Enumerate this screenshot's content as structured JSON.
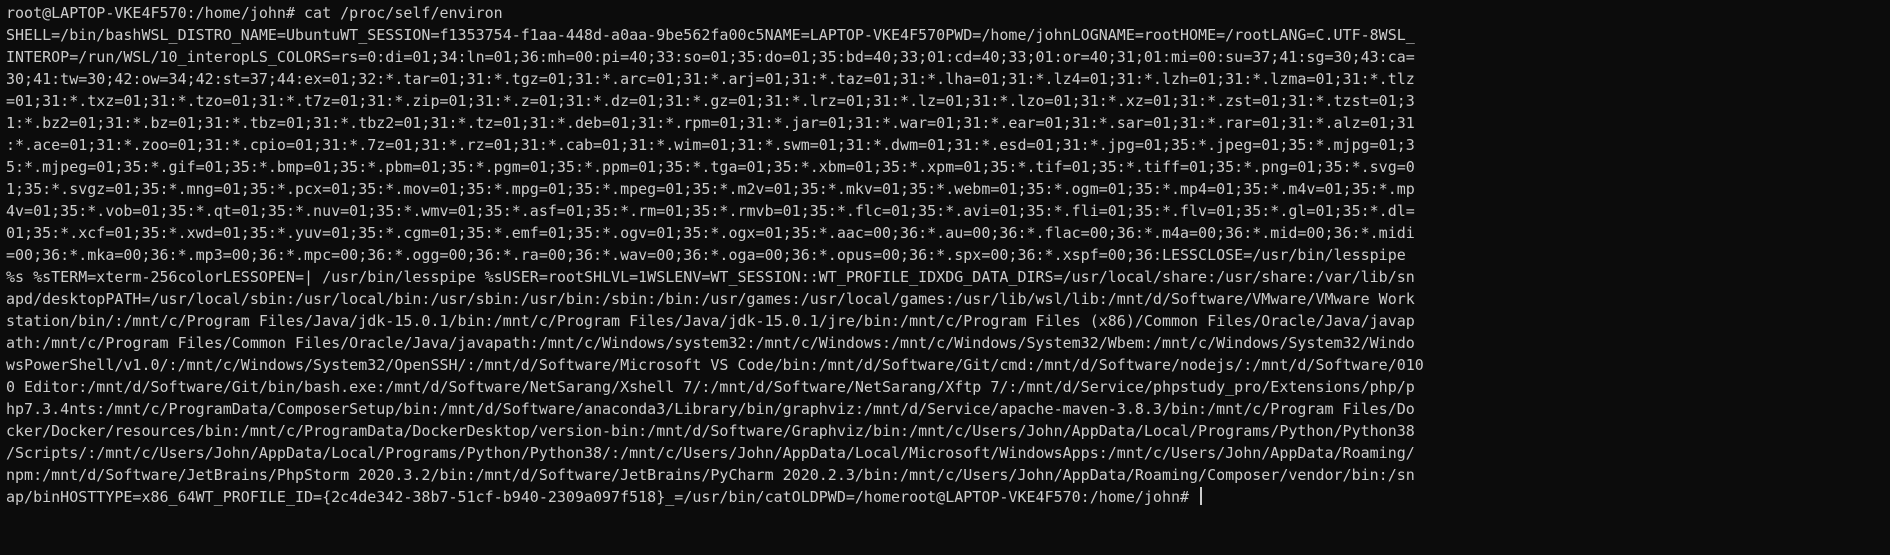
{
  "terminal": {
    "prompt": "root@LAPTOP-VKE4F570:/home/john#",
    "command": "cat /proc/self/environ",
    "output_lines": [
      "SHELL=/bin/bashWSL_DISTRO_NAME=UbuntuWT_SESSION=f1353754-f1aa-448d-a0aa-9be562fa00c5NAME=LAPTOP-VKE4F570PWD=/home/johnLOGNAME=rootHOME=/rootLANG=C.UTF-8WSL_",
      "INTEROP=/run/WSL/10_interopLS_COLORS=rs=0:di=01;34:ln=01;36:mh=00:pi=40;33:so=01;35:do=01;35:bd=40;33;01:cd=40;33;01:or=40;31;01:mi=00:su=37;41:sg=30;43:ca=",
      "30;41:tw=30;42:ow=34;42:st=37;44:ex=01;32:*.tar=01;31:*.tgz=01;31:*.arc=01;31:*.arj=01;31:*.taz=01;31:*.lha=01;31:*.lz4=01;31:*.lzh=01;31:*.lzma=01;31:*.tlz",
      "=01;31:*.txz=01;31:*.tzo=01;31:*.t7z=01;31:*.zip=01;31:*.z=01;31:*.dz=01;31:*.gz=01;31:*.lrz=01;31:*.lz=01;31:*.lzo=01;31:*.xz=01;31:*.zst=01;31:*.tzst=01;3",
      "1:*.bz2=01;31:*.bz=01;31:*.tbz=01;31:*.tbz2=01;31:*.tz=01;31:*.deb=01;31:*.rpm=01;31:*.jar=01;31:*.war=01;31:*.ear=01;31:*.sar=01;31:*.rar=01;31:*.alz=01;31",
      ":*.ace=01;31:*.zoo=01;31:*.cpio=01;31:*.7z=01;31:*.rz=01;31:*.cab=01;31:*.wim=01;31:*.swm=01;31:*.dwm=01;31:*.esd=01;31:*.jpg=01;35:*.jpeg=01;35:*.mjpg=01;3",
      "5:*.mjpeg=01;35:*.gif=01;35:*.bmp=01;35:*.pbm=01;35:*.pgm=01;35:*.ppm=01;35:*.tga=01;35:*.xbm=01;35:*.xpm=01;35:*.tif=01;35:*.tiff=01;35:*.png=01;35:*.svg=0",
      "1;35:*.svgz=01;35:*.mng=01;35:*.pcx=01;35:*.mov=01;35:*.mpg=01;35:*.mpeg=01;35:*.m2v=01;35:*.mkv=01;35:*.webm=01;35:*.ogm=01;35:*.mp4=01;35:*.m4v=01;35:*.mp",
      "4v=01;35:*.vob=01;35:*.qt=01;35:*.nuv=01;35:*.wmv=01;35:*.asf=01;35:*.rm=01;35:*.rmvb=01;35:*.flc=01;35:*.avi=01;35:*.fli=01;35:*.flv=01;35:*.gl=01;35:*.dl=",
      "01;35:*.xcf=01;35:*.xwd=01;35:*.yuv=01;35:*.cgm=01;35:*.emf=01;35:*.ogv=01;35:*.ogx=01;35:*.aac=00;36:*.au=00;36:*.flac=00;36:*.m4a=00;36:*.mid=00;36:*.midi",
      "=00;36:*.mka=00;36:*.mp3=00;36:*.mpc=00;36:*.ogg=00;36:*.ra=00;36:*.wav=00;36:*.oga=00;36:*.opus=00;36:*.spx=00;36:*.xspf=00;36:LESSCLOSE=/usr/bin/lesspipe",
      "%s %sTERM=xterm-256colorLESSOPEN=| /usr/bin/lesspipe %sUSER=rootSHLVL=1WSLENV=WT_SESSION::WT_PROFILE_IDXDG_DATA_DIRS=/usr/local/share:/usr/share:/var/lib/sn",
      "apd/desktopPATH=/usr/local/sbin:/usr/local/bin:/usr/sbin:/usr/bin:/sbin:/bin:/usr/games:/usr/local/games:/usr/lib/wsl/lib:/mnt/d/Software/VMware/VMware Work",
      "station/bin/:/mnt/c/Program Files/Java/jdk-15.0.1/bin:/mnt/c/Program Files/Java/jdk-15.0.1/jre/bin:/mnt/c/Program Files (x86)/Common Files/Oracle/Java/javap",
      "ath:/mnt/c/Program Files/Common Files/Oracle/Java/javapath:/mnt/c/Windows/system32:/mnt/c/Windows:/mnt/c/Windows/System32/Wbem:/mnt/c/Windows/System32/Windo",
      "wsPowerShell/v1.0/:/mnt/c/Windows/System32/OpenSSH/:/mnt/d/Software/Microsoft VS Code/bin:/mnt/d/Software/Git/cmd:/mnt/d/Software/nodejs/:/mnt/d/Software/010",
      "0 Editor:/mnt/d/Software/Git/bin/bash.exe:/mnt/d/Software/NetSarang/Xshell 7/:/mnt/d/Software/NetSarang/Xftp 7/:/mnt/d/Service/phpstudy_pro/Extensions/php/p",
      "hp7.3.4nts:/mnt/c/ProgramData/ComposerSetup/bin:/mnt/d/Software/anaconda3/Library/bin/graphviz:/mnt/d/Service/apache-maven-3.8.3/bin:/mnt/c/Program Files/Do",
      "cker/Docker/resources/bin:/mnt/c/ProgramData/DockerDesktop/version-bin:/mnt/d/Software/Graphviz/bin:/mnt/c/Users/John/AppData/Local/Programs/Python/Python38",
      "/Scripts/:/mnt/c/Users/John/AppData/Local/Programs/Python/Python38/:/mnt/c/Users/John/AppData/Local/Microsoft/WindowsApps:/mnt/c/Users/John/AppData/Roaming/",
      "npm:/mnt/d/Software/JetBrains/PhpStorm 2020.3.2/bin:/mnt/d/Software/JetBrains/PyCharm 2020.2.3/bin:/mnt/c/Users/John/AppData/Roaming/Composer/vendor/bin:/sn",
      "ap/binHOSTTYPE=x86_64WT_PROFILE_ID={2c4de342-38b7-51cf-b940-2309a097f518}_=/usr/bin/catOLDPWD=/homeroot@LAPTOP-VKE4F570:/home/john#"
    ]
  }
}
